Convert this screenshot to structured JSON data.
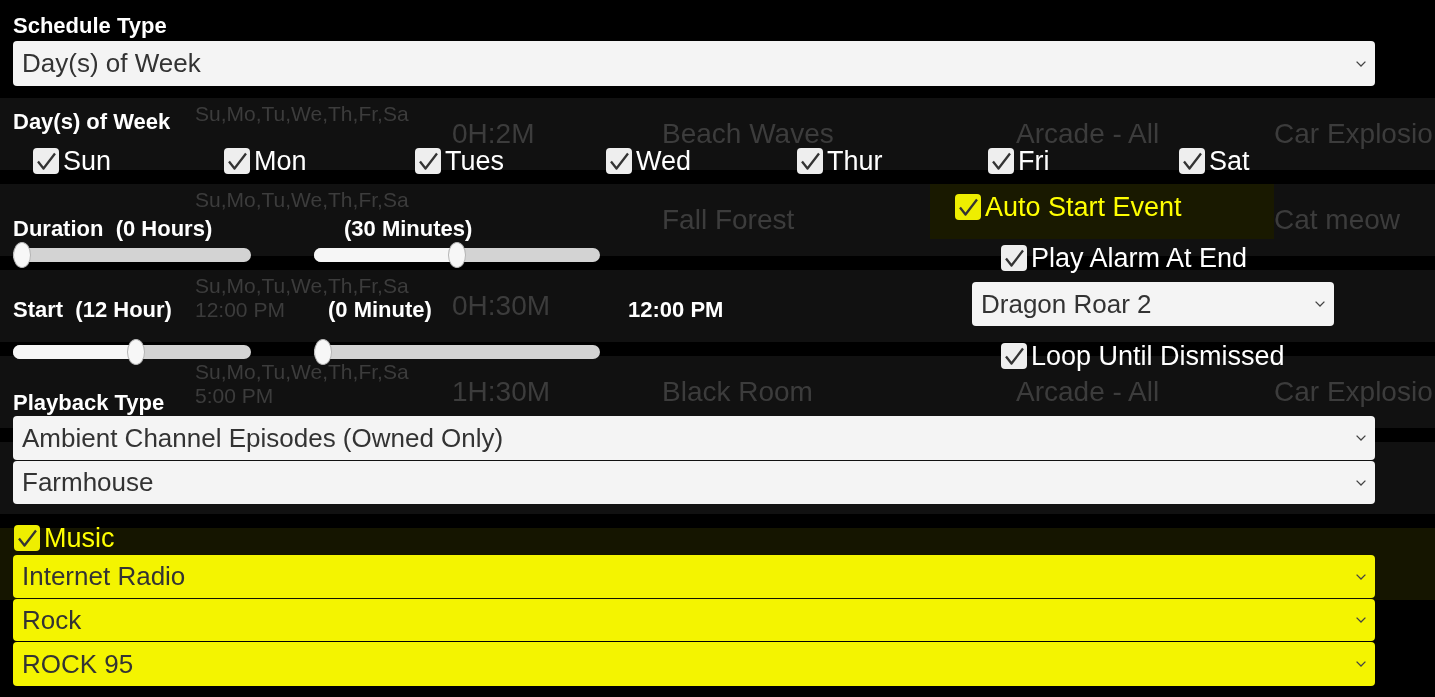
{
  "background_list": {
    "rows": [
      {
        "days": "Su,Mo,Tu,We,Th,Fr,Sa",
        "duration": "0H:2M",
        "ambient": "Beach Waves",
        "music": "Arcade - All",
        "alarm": "Car Explosio",
        "music_highlight": false,
        "selected": false
      },
      {
        "days": "Su,Mo,Tu,We,Th,Fr,Sa",
        "ambient": "Fall Forest",
        "alarm": "Cat meow",
        "music_highlight": true,
        "selected": false
      },
      {
        "days": "Su,Mo,Tu,We,Th,Fr,Sa",
        "time": "12:00 PM",
        "duration": "0H:30M",
        "music_highlight": false,
        "selected": false
      },
      {
        "days": "Su,Mo,Tu,We,Th,Fr,Sa",
        "time": "5:00 PM",
        "duration": "1H:30M",
        "ambient": "Black Room",
        "music": "Arcade - All",
        "alarm": "Car Explosio",
        "music_highlight": false,
        "selected": false
      },
      {
        "music_highlight": false,
        "selected": false
      },
      {
        "music_highlight": false,
        "selected": true
      }
    ]
  },
  "dialog": {
    "schedule_type": {
      "label": "Schedule Type",
      "value": "Day(s) of Week"
    },
    "days_of_week": {
      "label": "Day(s) of Week",
      "items": [
        {
          "label": "Sun",
          "checked": true
        },
        {
          "label": "Mon",
          "checked": true
        },
        {
          "label": "Tues",
          "checked": true
        },
        {
          "label": "Wed",
          "checked": true
        },
        {
          "label": "Thur",
          "checked": true
        },
        {
          "label": "Fri",
          "checked": true
        },
        {
          "label": "Sat",
          "checked": true
        }
      ]
    },
    "duration": {
      "hours": {
        "label": "Duration  (0 Hours)",
        "level": 0
      },
      "minutes": {
        "label": "(30 Minutes)",
        "level": 0.5
      }
    },
    "start": {
      "hours": {
        "label": "Start  (12 Hour)",
        "level": 0.52
      },
      "minutes": {
        "label": "(0 Minute)",
        "level": 0
      },
      "time": "12:00 PM"
    },
    "auto_start": {
      "label": "Auto Start Event",
      "checked": true
    },
    "play_alarm": {
      "label": "Play Alarm At End",
      "checked": true
    },
    "alarm_sound": {
      "value": "Dragon Roar 2"
    },
    "loop": {
      "label": "Loop Until Dismissed",
      "checked": true
    },
    "playback_type": {
      "label": "Playback Type",
      "value": "Ambient Channel Episodes (Owned Only)",
      "channel": "Farmhouse"
    },
    "music": {
      "label": "Music",
      "checked": true,
      "selections": [
        "Internet Radio",
        "Rock",
        "ROCK 95"
      ]
    }
  }
}
